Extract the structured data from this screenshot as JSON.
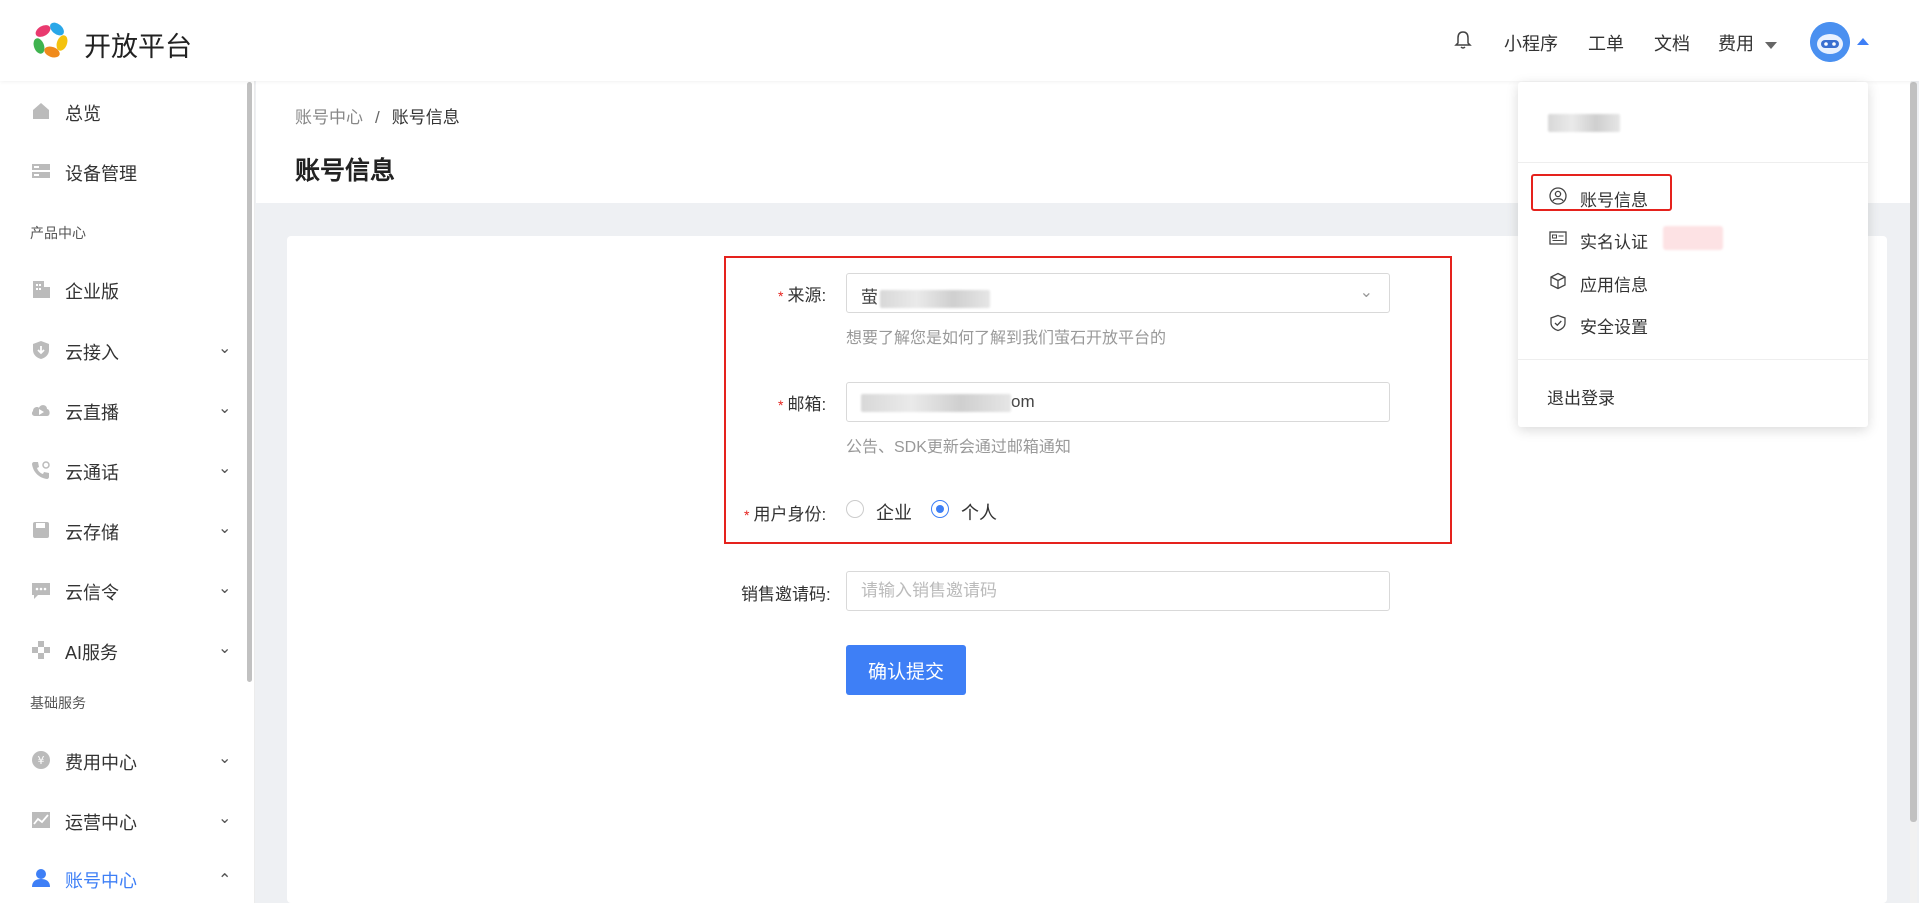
{
  "header": {
    "logo_text": "开放平台",
    "nav": [
      "小程序",
      "工单",
      "文档",
      "费用"
    ]
  },
  "sidebar": {
    "items": [
      {
        "label": "总览"
      },
      {
        "label": "设备管理"
      },
      {
        "label": "企业版"
      },
      {
        "label": "云接入"
      },
      {
        "label": "云直播"
      },
      {
        "label": "云通话"
      },
      {
        "label": "云存储"
      },
      {
        "label": "云信令"
      },
      {
        "label": "AI服务"
      },
      {
        "label": "费用中心"
      },
      {
        "label": "运营中心"
      },
      {
        "label": "账号中心"
      }
    ],
    "groups": [
      "产品中心",
      "基础服务"
    ]
  },
  "breadcrumb": {
    "parent": "账号中心",
    "separator": "/",
    "current": "账号信息"
  },
  "page_title": "账号信息",
  "form": {
    "source_label": "来源:",
    "source_value_prefix": "萤",
    "source_help": "想要了解您是如何了解到我们萤石开放平台的",
    "email_label": "邮箱:",
    "email_value_suffix": "om",
    "email_help": "公告、SDK更新会通过邮箱通知",
    "identity_label": "用户身份:",
    "identity_options": [
      "企业",
      "个人"
    ],
    "identity_selected": "个人",
    "invite_label": "销售邀请码:",
    "invite_placeholder": "请输入销售邀请码",
    "submit_label": "确认提交"
  },
  "dropdown": {
    "items": [
      "账号信息",
      "实名认证",
      "应用信息",
      "安全设置"
    ],
    "logout": "退出登录"
  },
  "colors": {
    "accent": "#3e7ff6",
    "highlight": "#e5221d"
  }
}
